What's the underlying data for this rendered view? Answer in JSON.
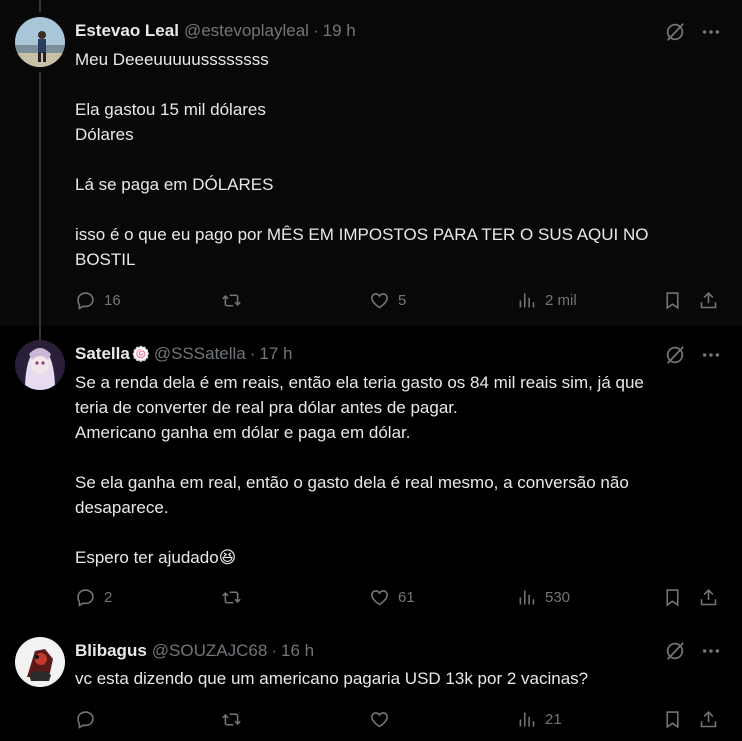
{
  "tweets": [
    {
      "name": "Estevao Leal",
      "handle": "@estevoplayleal",
      "time": "19 h",
      "lines": [
        "Meu Deeeuuuuussssssss",
        "",
        "Ela gastou 15 mil dólares",
        "Dólares",
        "",
        "Lá se paga em DÓLARES",
        "",
        "isso é o que eu pago por MÊS EM IMPOSTOS PARA TER O SUS AQUI NO",
        "BOSTIL"
      ],
      "replies": "16",
      "retweets": "",
      "likes": "5",
      "views": "2 mil"
    },
    {
      "name": "Satella",
      "name_badge": "🍥",
      "handle": "@SSSatella",
      "time": "17 h",
      "lines": [
        "Se a renda dela é em reais, então ela teria gasto os 84 mil reais sim, já que",
        "teria de converter de real pra dólar antes de pagar.",
        "Americano ganha em dólar e paga em dólar.",
        "",
        "Se ela ganha em real, então o gasto dela é real mesmo, a conversão não",
        "desaparece.",
        "",
        "Espero ter ajudado😆"
      ],
      "replies": "2",
      "retweets": "",
      "likes": "61",
      "views": "530"
    },
    {
      "name": "Blibagus",
      "handle": "@SOUZAJC68",
      "time": "16 h",
      "lines": [
        "vc esta dizendo que um americano pagaria USD 13k por 2 vacinas?"
      ],
      "replies": "",
      "retweets": "",
      "likes": "",
      "views": "21"
    }
  ],
  "sep": "·",
  "colors": {
    "background": "#000000",
    "text": "#e7e9ea",
    "muted": "#71767b",
    "thread_line": "#333639"
  }
}
